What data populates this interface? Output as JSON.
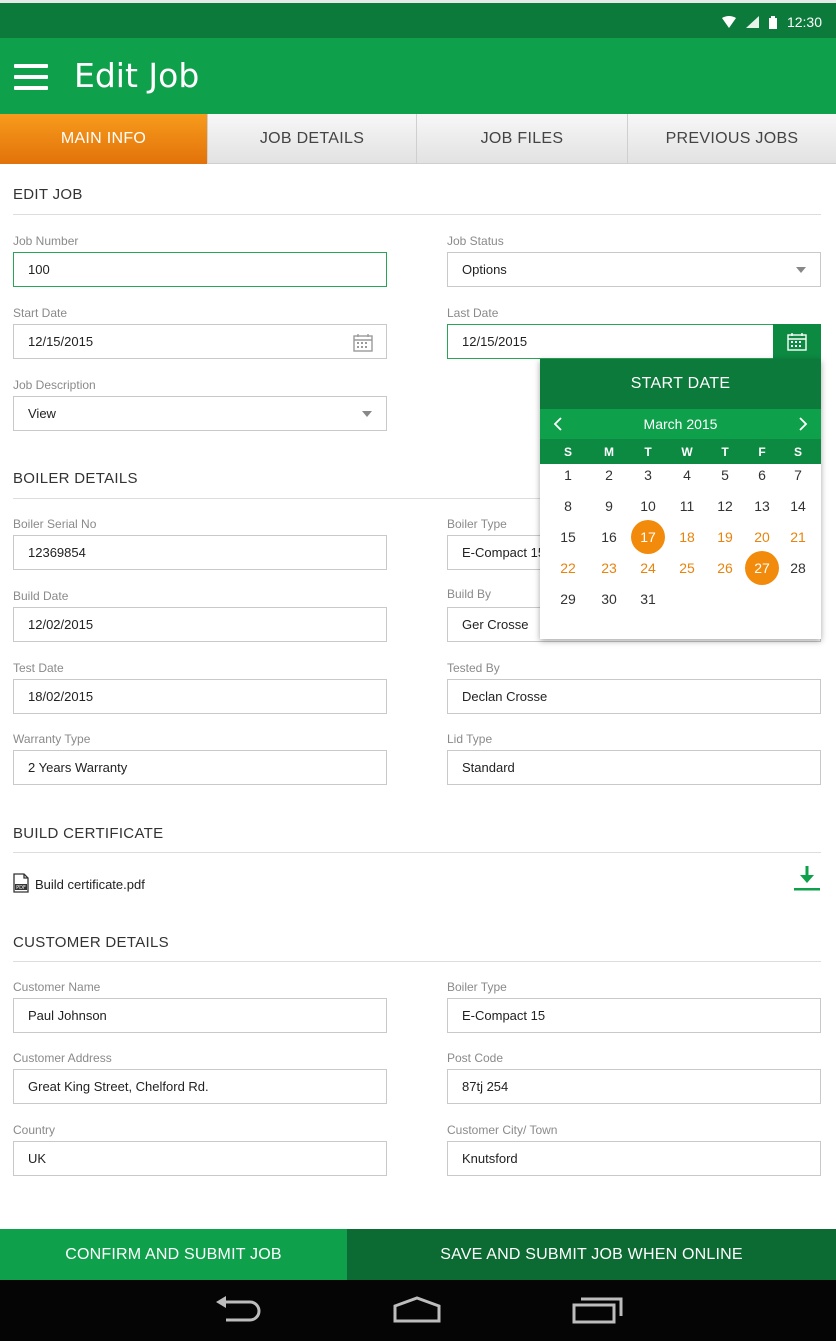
{
  "status_bar": {
    "time": "12:30"
  },
  "app_bar": {
    "title": "Edit Job"
  },
  "tabs": [
    {
      "label": "MAIN INFO",
      "active": true
    },
    {
      "label": "JOB DETAILS",
      "active": false
    },
    {
      "label": "JOB FILES",
      "active": false
    },
    {
      "label": "PREVIOUS JOBS",
      "active": false
    }
  ],
  "edit_job": {
    "title": "EDIT JOB",
    "job_number": {
      "label": "Job Number",
      "value": "100"
    },
    "job_status": {
      "label": "Job Status",
      "value": "Options"
    },
    "start_date": {
      "label": "Start Date",
      "value": "12/15/2015"
    },
    "last_date": {
      "label": "Last Date",
      "value": "12/15/2015"
    },
    "job_description": {
      "label": "Job Description",
      "value": "View"
    }
  },
  "date_picker": {
    "header": "START DATE",
    "month": "March 2015",
    "weekdays": [
      "S",
      "M",
      "T",
      "W",
      "T",
      "F",
      "S"
    ],
    "weeks": [
      [
        "1",
        "2",
        "3",
        "4",
        "5",
        "6",
        "7"
      ],
      [
        "8",
        "9",
        "10",
        "11",
        "12",
        "13",
        "14"
      ],
      [
        "15",
        "16",
        "17",
        "18",
        "19",
        "20",
        "21"
      ],
      [
        "22",
        "23",
        "24",
        "25",
        "26",
        "27",
        "28"
      ],
      [
        "29",
        "30",
        "31",
        "",
        "",
        "",
        ""
      ]
    ],
    "selected_start": "17",
    "selected_end": "27",
    "accent_color": "#f28b0c"
  },
  "boiler_details": {
    "title": "BOILER DETAILS",
    "serial_no": {
      "label": "Boiler Serial No",
      "value": "12369854"
    },
    "boiler_type": {
      "label": "Boiler Type",
      "value": "E-Compact 15"
    },
    "build_date": {
      "label": "Build Date",
      "value": "12/02/2015"
    },
    "build_by": {
      "label": "Build By",
      "value": "Ger Crosse"
    },
    "test_date": {
      "label": "Test Date",
      "value": "18/02/2015"
    },
    "tested_by": {
      "label": "Tested By",
      "value": "Declan Crosse"
    },
    "warranty_type": {
      "label": "Warranty Type",
      "value": "2 Years Warranty"
    },
    "lid_type": {
      "label": "Lid Type",
      "value": "Standard"
    }
  },
  "build_certificate": {
    "title": "BUILD CERTIFICATE",
    "file_name": "Build certificate.pdf"
  },
  "customer_details": {
    "title": "CUSTOMER DETAILS",
    "customer_name": {
      "label": "Customer Name",
      "value": "Paul Johnson"
    },
    "boiler_type": {
      "label": "Boiler Type",
      "value": "E-Compact 15"
    },
    "customer_address": {
      "label": "Customer Address",
      "value": "Great King Street, Chelford Rd."
    },
    "post_code": {
      "label": "Post Code",
      "value": "87tj 254"
    },
    "country": {
      "label": "Country",
      "value": "UK"
    },
    "city": {
      "label": "Customer City/ Town",
      "value": "Knutsford"
    }
  },
  "actions": {
    "confirm_label": "CONFIRM AND SUBMIT JOB",
    "save_label": "SAVE AND SUBMIT JOB WHEN ONLINE"
  },
  "colors": {
    "primary": "#0fa04c",
    "primary_dark": "#0c7a3a",
    "accent": "#f28b0c"
  },
  "icons": [
    "menu-icon",
    "calendar-icon",
    "pdf-icon",
    "download-icon",
    "back-icon",
    "home-icon",
    "recents-icon",
    "wifi-icon",
    "signal-icon",
    "battery-icon"
  ]
}
